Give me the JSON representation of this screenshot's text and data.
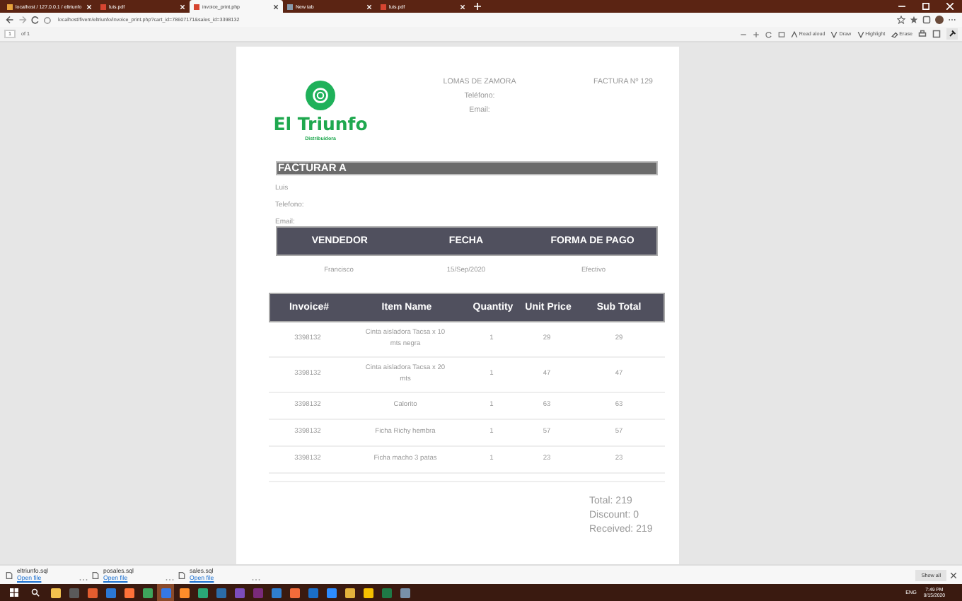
{
  "browser": {
    "tabs": [
      {
        "title": "localhost / 127.0.0.1 / eltriunfo",
        "kind": "db",
        "selected": false
      },
      {
        "title": "luis.pdf",
        "kind": "pdf",
        "selected": false
      },
      {
        "title": "invoice_print.php",
        "kind": "pdf",
        "selected": true
      },
      {
        "title": "New tab",
        "kind": "page",
        "selected": false
      },
      {
        "title": "luis.pdf",
        "kind": "pdf",
        "selected": false
      }
    ],
    "address": "localhost/fivem/eltriunfo/invoice_print.php?cart_id=78607171&sales_id=3398132"
  },
  "pdf_toolbar": {
    "page": "1",
    "of": "of 1",
    "tools": [
      {
        "label": "Read aloud",
        "kind": "read"
      },
      {
        "label": "Draw",
        "kind": "draw"
      },
      {
        "label": "Highlight",
        "kind": "highlight"
      },
      {
        "label": "Erase",
        "kind": "erase"
      }
    ]
  },
  "invoice": {
    "brand": "El Triunfo",
    "tagline": "Distribuidora",
    "city": "LOMAS DE ZAMORA",
    "phone_label": "Teléfono:",
    "email_label": "Email:",
    "number": "FACTURA Nº 129",
    "bill_to": {
      "heading": "FACTURAR A",
      "lines": [
        "Luis",
        "Telefono:",
        "Email:"
      ]
    },
    "sale": {
      "columns": [
        "VENDEDOR",
        "FECHA",
        "FORMA DE PAGO"
      ],
      "values": [
        "Francisco",
        "15/Sep/2020",
        "Efectivo"
      ]
    },
    "items": {
      "columns": [
        "Invoice#",
        "Item Name",
        "Quantity",
        "Unit Price",
        "Sub Total"
      ],
      "rows": [
        [
          "3398132",
          "Cinta aisladora Tacsa x 10 mts negra",
          "1",
          "29",
          "29"
        ],
        [
          "3398132",
          "Cinta aisladora Tacsa x 20 mts",
          "1",
          "47",
          "47"
        ],
        [
          "3398132",
          "Calorito",
          "1",
          "63",
          "63"
        ],
        [
          "3398132",
          "Ficha Richy hembra",
          "1",
          "57",
          "57"
        ],
        [
          "3398132",
          "Ficha macho 3 patas",
          "1",
          "23",
          "23"
        ]
      ]
    },
    "totals": [
      "Total: 219",
      "Discount: 0",
      "Received: 219"
    ]
  },
  "downloads": {
    "files": [
      {
        "name": "eltriunfo.sql",
        "action": "Open file"
      },
      {
        "name": "posales.sql",
        "action": "Open file"
      },
      {
        "name": "sales.sql",
        "action": "Open file"
      }
    ],
    "show_all": "Show all"
  },
  "taskbar": {
    "lang": "ENG",
    "time": "7:49 PM",
    "date": "9/15/2020"
  }
}
